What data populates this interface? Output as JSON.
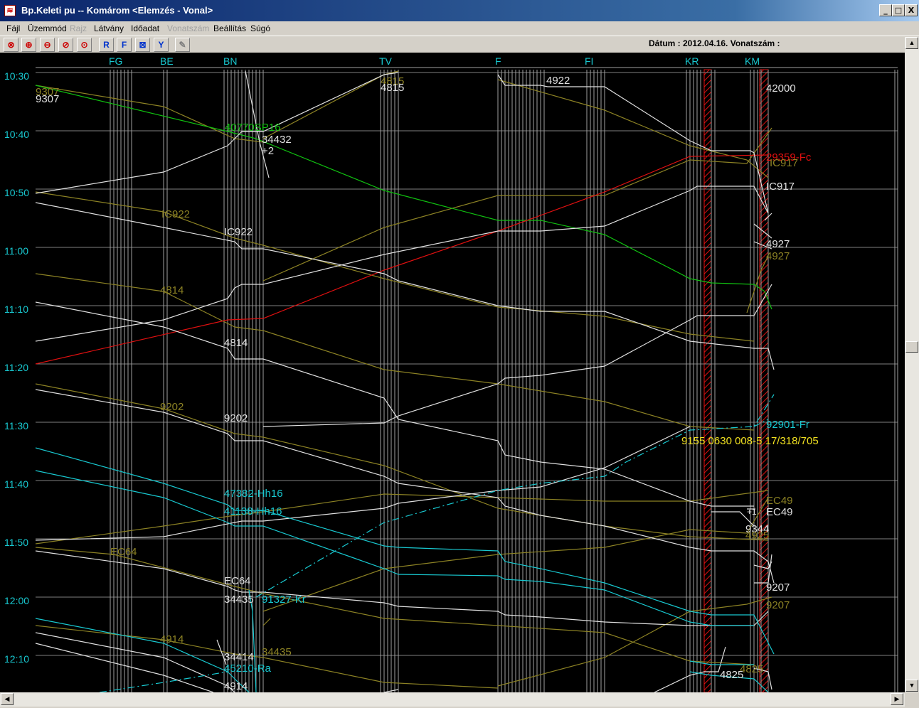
{
  "window": {
    "title": "Bp.Keleti pu --  Komárom <Elemzés - Vonal>",
    "buttons": [
      "_",
      "□",
      "X"
    ]
  },
  "menu": [
    {
      "label": "Fájl",
      "enabled": true
    },
    {
      "label": "Üzemmód",
      "enabled": true
    },
    {
      "label": "Rajz",
      "enabled": false
    },
    {
      "label": "Látvány",
      "enabled": true
    },
    {
      "label": "Időadat",
      "enabled": true
    },
    {
      "label": "Vonatszám",
      "enabled": false
    },
    {
      "label": "Beállítás",
      "enabled": true
    },
    {
      "label": "Súgó",
      "enabled": true
    }
  ],
  "toolbar": {
    "buttons": [
      {
        "name": "zoom-cancel-icon",
        "glyph": "⊗"
      },
      {
        "name": "zoom-in-icon",
        "glyph": "⊕"
      },
      {
        "name": "zoom-out-icon",
        "glyph": "⊖"
      },
      {
        "name": "zoom-reset-icon",
        "glyph": "⊘"
      },
      {
        "name": "zoom-fit-icon",
        "glyph": "⊙"
      },
      {
        "name": "r-filter-icon",
        "glyph": "R"
      },
      {
        "name": "f-filter-icon",
        "glyph": "F"
      },
      {
        "name": "grid-icon",
        "glyph": "⊠"
      },
      {
        "name": "funnel-icon",
        "glyph": "Y"
      },
      {
        "name": "edit-icon",
        "glyph": "✎"
      }
    ],
    "status_text": "Dátum : 2012.04.16. Vonatszám :"
  },
  "stations": [
    {
      "code": "FG"
    },
    {
      "code": "BE"
    },
    {
      "code": "BN"
    },
    {
      "code": "TV"
    },
    {
      "code": "F"
    },
    {
      "code": "FI"
    },
    {
      "code": "KR"
    },
    {
      "code": "KM"
    }
  ],
  "time_labels": [
    "10:30",
    "10:40",
    "10:50",
    "11:00",
    "11:10",
    "11:20",
    "11:30",
    "11:40",
    "11:50",
    "12:00",
    "12:10"
  ],
  "colors": {
    "white": "#e0e0e0",
    "olive": "#8c8224",
    "green": "#10c010",
    "red": "#e01010",
    "cyan": "#18c8d0",
    "yellow": "#f0e020",
    "grid": "#808080",
    "time_text": "#18c8d0"
  },
  "train_labels": [
    {
      "text": "9307",
      "color": "white"
    },
    {
      "text": "9307",
      "color": "olive"
    },
    {
      "text": "40770SP16",
      "color": "green"
    },
    {
      "text": "34432",
      "color": "white"
    },
    {
      "text": "+2",
      "color": "white"
    },
    {
      "text": "4815",
      "color": "olive"
    },
    {
      "text": "4815",
      "color": "white"
    },
    {
      "text": "4922",
      "color": "white"
    },
    {
      "text": "42000",
      "color": "white"
    },
    {
      "text": "29359-Fc",
      "color": "red"
    },
    {
      "text": "IC917",
      "color": "olive"
    },
    {
      "text": "IC917",
      "color": "white"
    },
    {
      "text": "IC922",
      "color": "olive"
    },
    {
      "text": "IC922",
      "color": "white"
    },
    {
      "text": "4927",
      "color": "white"
    },
    {
      "text": "4927",
      "color": "olive"
    },
    {
      "text": "4814",
      "color": "olive"
    },
    {
      "text": "4814",
      "color": "white"
    },
    {
      "text": "9202",
      "color": "olive"
    },
    {
      "text": "9202",
      "color": "white"
    },
    {
      "text": "92901-Fr",
      "color": "cyan"
    },
    {
      "text": "9155 0630 008-5 17/318/705",
      "color": "yellow"
    },
    {
      "text": "47382-Hh16",
      "color": "cyan"
    },
    {
      "text": "41138-Hh16",
      "color": "cyan"
    },
    {
      "text": "EC49",
      "color": "olive"
    },
    {
      "text": "EC49",
      "color": "white"
    },
    {
      "text": "+1",
      "color": "white"
    },
    {
      "text": "9344",
      "color": "white"
    },
    {
      "text": "4925",
      "color": "olive"
    },
    {
      "text": "EC64",
      "color": "olive"
    },
    {
      "text": "EC64",
      "color": "white"
    },
    {
      "text": "34435",
      "color": "white"
    },
    {
      "text": "91327-Kr",
      "color": "cyan"
    },
    {
      "text": "9207",
      "color": "white"
    },
    {
      "text": "9207",
      "color": "olive"
    },
    {
      "text": "4914",
      "color": "olive"
    },
    {
      "text": "34414",
      "color": "white"
    },
    {
      "text": "34435",
      "color": "olive"
    },
    {
      "text": "45210-Ra",
      "color": "cyan"
    },
    {
      "text": "4914",
      "color": "white"
    },
    {
      "text": "4825",
      "color": "white"
    },
    {
      "text": "4825",
      "color": "olive"
    }
  ]
}
